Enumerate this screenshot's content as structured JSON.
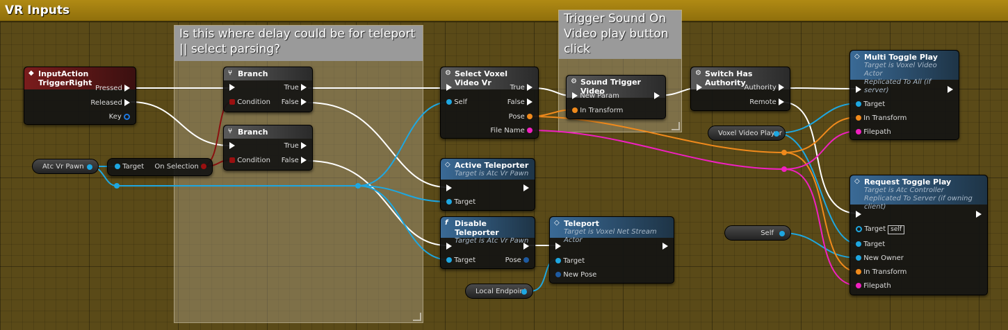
{
  "header": {
    "title": "VR Inputs"
  },
  "colors": {
    "exec": "#ffffff",
    "object": "#1ea7e1",
    "struct": "#f08a1c",
    "string": "#f020c0",
    "bool": "#9a1010"
  },
  "comments": [
    {
      "text": "Is this where delay could be for teleport || select parsing?"
    },
    {
      "text": "Trigger Sound On Video play button click"
    }
  ],
  "nodes": {
    "input_action": {
      "title": "InputAction TriggerRight",
      "pins": [
        "Pressed",
        "Released",
        "Key"
      ]
    },
    "branch1": {
      "title": "Branch",
      "pins": [
        "True",
        "False",
        "Condition"
      ]
    },
    "branch2": {
      "title": "Branch",
      "pins": [
        "True",
        "False",
        "Condition"
      ]
    },
    "select_voxel": {
      "title": "Select Voxel Video Vr",
      "pins": [
        "Self",
        "True",
        "False",
        "Pose",
        "File Name"
      ]
    },
    "sound_trigger": {
      "title": "Sound Trigger Video",
      "pins": [
        "New Param",
        "In Transform"
      ]
    },
    "switch_auth": {
      "title": "Switch Has Authority",
      "pins": [
        "Authority",
        "Remote"
      ]
    },
    "multi_toggle": {
      "title": "Multi Toggle Play",
      "sub1": "Target is Voxel Video Actor",
      "sub2": "Replicated To All (if server)",
      "pins": [
        "Target",
        "In Transform",
        "Filepath"
      ]
    },
    "active_teleporter": {
      "title": "Active Teleporter",
      "sub1": "Target is Atc Vr Pawn",
      "pins": [
        "Target"
      ]
    },
    "disable_teleporter": {
      "title": "Disable Teleporter",
      "sub1": "Target is Atc Vr Pawn",
      "pins": [
        "Target",
        "Pose"
      ]
    },
    "teleport": {
      "title": "Teleport",
      "sub1": "Target is Voxel Net Stream Actor",
      "pins": [
        "Target",
        "New Pose"
      ]
    },
    "request_toggle": {
      "title": "Request Toggle Play",
      "sub1": "Target is Atc Controller",
      "sub2": "Replicated To Server (if owning client)",
      "pins": [
        "Target",
        "Target",
        "New Owner",
        "In Transform",
        "Filepath"
      ],
      "self_tag": "self"
    },
    "on_selection": {
      "pins": [
        "Target",
        "On Selection"
      ]
    }
  },
  "variables": {
    "atc_vr_pawn": "Atc Vr Pawn",
    "voxel_video_player": "Voxel Video Player",
    "self": "Self",
    "local_endpoint": "Local Endpoint"
  }
}
